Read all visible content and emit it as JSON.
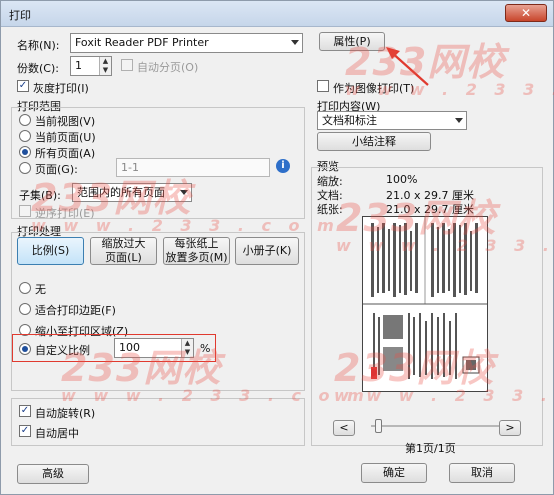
{
  "window": {
    "title": "打印",
    "close_glyph": "✕"
  },
  "printer": {
    "name_label": "名称(N):",
    "name_value": "Foxit Reader PDF Printer",
    "properties_button": "属性(P)",
    "copies_label": "份数(C):",
    "copies_value": "1",
    "collate_label": "自动分页(O)",
    "grayscale_label": "灰度打印(I)",
    "print_as_image_label": "作为图像打印(T)"
  },
  "print_range": {
    "legend": "打印范围",
    "current_view": "当前视图(V)",
    "current_page": "当前页面(U)",
    "all_pages": "所有页面(A)",
    "pages": "页面(G):",
    "pages_value": "1-1",
    "subset_label": "子集(B):",
    "subset_value": "范围内的所有页面",
    "reverse_label": "逆序打印(E)",
    "selected": "all_pages"
  },
  "print_handling": {
    "legend": "打印处理",
    "btn_scale": "比例(S)",
    "btn_shrink": "缩放过大\n页面(L)",
    "btn_multi": "每张纸上\n放置多页(M)",
    "btn_booklet": "小册子(K)",
    "opt_none": "无",
    "opt_fit_margins": "适合打印边距(F)",
    "opt_shrink_area": "缩小至打印区域(Z)",
    "opt_custom": "自定义比例",
    "custom_value": "100",
    "percent": "%",
    "selected": "custom"
  },
  "options": {
    "auto_rotate": "自动旋转(R)",
    "auto_center": "自动居中"
  },
  "print_content": {
    "legend": "打印内容(W)",
    "value": "文档和标注",
    "summarize_button": "小结注释"
  },
  "preview": {
    "legend": "预览",
    "zoom_label": "缩放:",
    "zoom_value": "100%",
    "doc_label": "文档:",
    "doc_value": "21.0 x 29.7 厘米",
    "paper_label": "纸张:",
    "paper_value": "21.0 x 29.7 厘米",
    "prev": "<",
    "next": ">",
    "page_indicator": "第1页/1页"
  },
  "footer": {
    "advanced": "高级",
    "ok": "确定",
    "cancel": "取消"
  },
  "watermark": {
    "text": "233网校",
    "domain": "w w w . 2 3 3 . c o m"
  },
  "colors": {
    "accent_red": "#e03a2f",
    "selection_blue": "#c4e3f8"
  }
}
